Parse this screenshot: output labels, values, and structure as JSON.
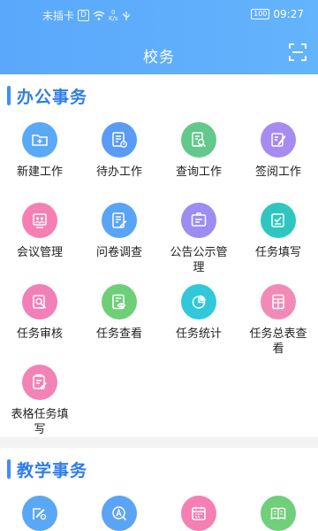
{
  "status_bar": {
    "carrier": "未插卡",
    "sim_badge": "D",
    "speed_value": "0",
    "speed_unit": "K/s",
    "battery": "100",
    "time": "09:27"
  },
  "header": {
    "title": "校务"
  },
  "sections": [
    {
      "title": "办公事务",
      "items": [
        {
          "label": "新建工作",
          "icon": "new-folder-icon",
          "color": "#5aa9f6"
        },
        {
          "label": "待办工作",
          "icon": "todo-list-icon",
          "color": "#5a9bf5"
        },
        {
          "label": "查询工作",
          "icon": "search-doc-icon",
          "color": "#62c98a"
        },
        {
          "label": "签阅工作",
          "icon": "sign-edit-icon",
          "color": "#a68bf0"
        },
        {
          "label": "会议管理",
          "icon": "meeting-icon",
          "color": "#f57fb3"
        },
        {
          "label": "问卷调查",
          "icon": "survey-icon",
          "color": "#5aa4f5"
        },
        {
          "label": "公告公示管理",
          "icon": "notice-board-icon",
          "color": "#9d8cf1"
        },
        {
          "label": "任务填写",
          "icon": "task-fill-icon",
          "color": "#2fc6c0"
        },
        {
          "label": "任务审核",
          "icon": "task-review-icon",
          "color": "#f27fb8"
        },
        {
          "label": "任务查看",
          "icon": "task-view-icon",
          "color": "#6fcf78"
        },
        {
          "label": "任务统计",
          "icon": "pie-chart-icon",
          "color": "#31c8d9"
        },
        {
          "label": "任务总表查看",
          "icon": "task-table-icon",
          "color": "#f28ab7"
        },
        {
          "label": "表格任务填写",
          "icon": "form-task-icon",
          "color": "#f283b7"
        }
      ]
    },
    {
      "title": "教学事务",
      "items": [
        {
          "label": "",
          "icon": "edit-search-icon",
          "color": "#5aa7f5"
        },
        {
          "label": "",
          "icon": "compass-icon",
          "color": "#5ba4f5"
        },
        {
          "label": "",
          "icon": "calendar-icon",
          "color": "#f57fb2"
        },
        {
          "label": "",
          "icon": "book-icon",
          "color": "#6fcf7a"
        }
      ]
    }
  ]
}
